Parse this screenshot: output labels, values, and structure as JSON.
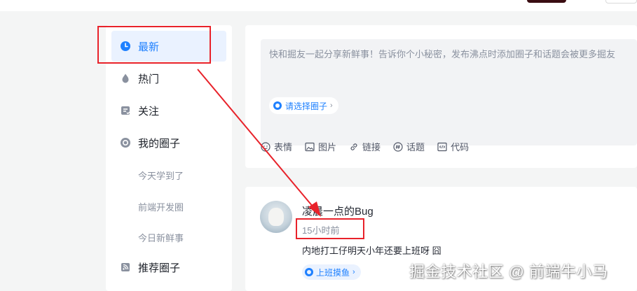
{
  "sidebar": {
    "items": [
      {
        "label": "最新",
        "icon": "clock-icon",
        "active": true
      },
      {
        "label": "热门",
        "icon": "flame-icon"
      },
      {
        "label": "关注",
        "icon": "follow-icon"
      },
      {
        "label": "我的圈子",
        "icon": "circle-icon"
      }
    ],
    "sub_items": [
      "今天学到了",
      "前端开发圈",
      "今日新鲜事"
    ],
    "recommend_label": "推荐圈子"
  },
  "composer": {
    "placeholder": "快和掘友一起分享新鲜事！告诉你个小秘密，发布沸点时添加圈子和话题会被更多掘友",
    "circle_select": "请选择圈子",
    "tools": [
      {
        "label": "表情",
        "icon": "emoji-icon"
      },
      {
        "label": "图片",
        "icon": "image-icon"
      },
      {
        "label": "链接",
        "icon": "link-icon"
      },
      {
        "label": "话题",
        "icon": "hashtag-icon"
      },
      {
        "label": "代码",
        "icon": "code-icon"
      }
    ]
  },
  "post": {
    "author": "凌晨一点的Bug",
    "time": "15小时前",
    "content": "内地打工仔明天小年还要上班呀 囧",
    "topic": "上班摸鱼"
  },
  "watermark": "掘金技术社区 @ 前端牛小马",
  "colors": {
    "accent": "#1e80ff",
    "annotation": "#e8222a"
  }
}
